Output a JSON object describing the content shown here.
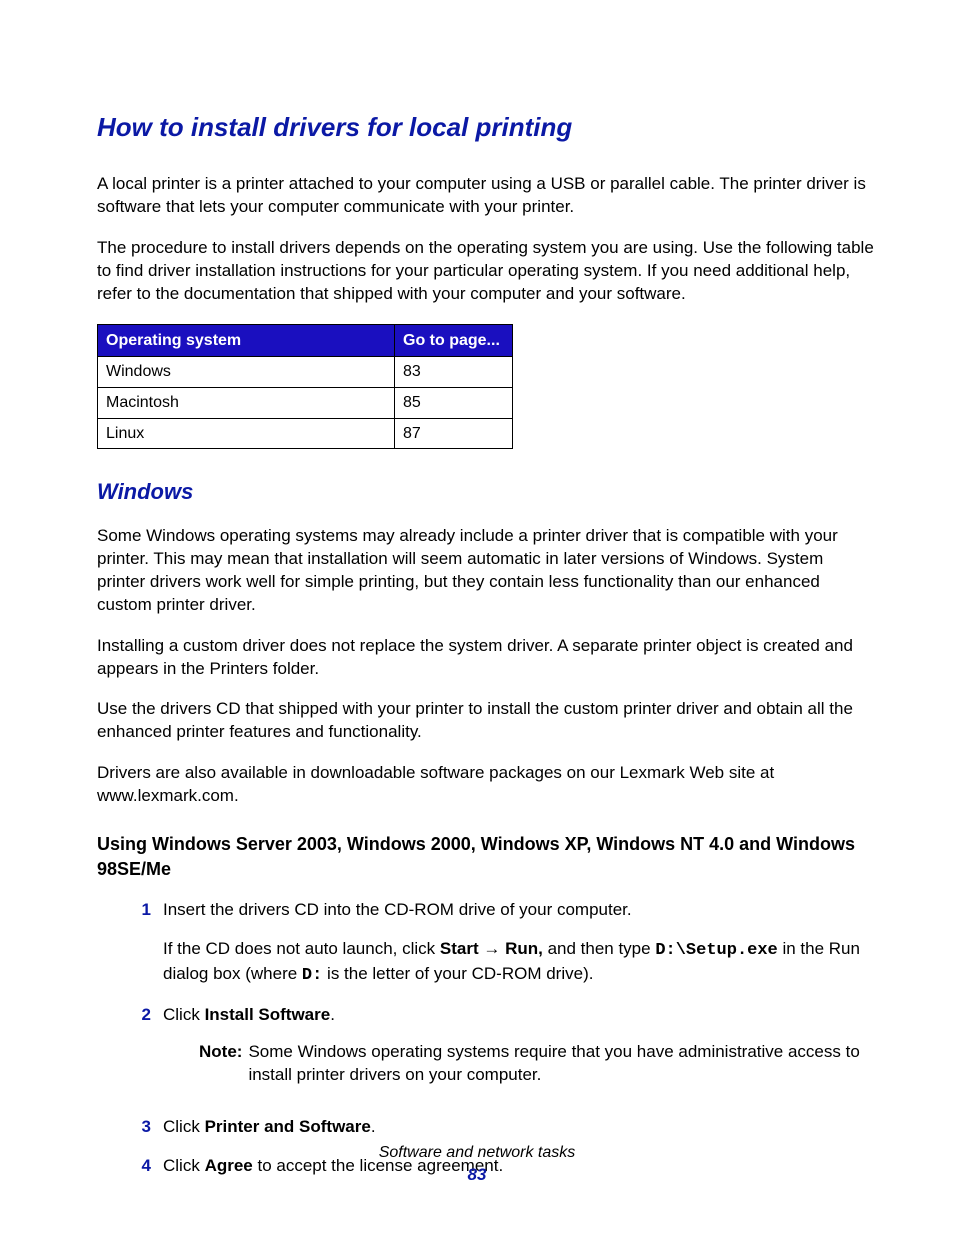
{
  "title": "How to install drivers for local printing",
  "intro1": "A local printer is a printer attached to your computer using a USB or parallel cable. The printer driver is software that lets your computer communicate with your printer.",
  "intro2": "The procedure to install drivers depends on the operating system you are using. Use the following table to find driver installation instructions for your particular operating system. If you need additional help, refer to the documentation that shipped with your computer and your software.",
  "table": {
    "h1": "Operating system",
    "h2": "Go to page...",
    "rows": [
      {
        "os": "Windows",
        "page": "83"
      },
      {
        "os": "Macintosh",
        "page": "85"
      },
      {
        "os": "Linux",
        "page": "87"
      }
    ]
  },
  "win_heading": "Windows",
  "win_p1": "Some Windows operating systems may already include a printer driver that is compatible with your printer. This may mean that installation will seem automatic in later versions of Windows. System printer drivers work well for simple printing, but they contain less functionality than our enhanced custom printer driver.",
  "win_p2": "Installing a custom driver does not replace the system driver. A separate printer object is created and appears in the Printers folder.",
  "win_p3": "Use the drivers CD that shipped with your printer to install the custom printer driver and obtain all the enhanced printer features and functionality.",
  "win_p4": "Drivers are also available in downloadable software packages on our Lexmark Web site at www.lexmark.com.",
  "sub_heading": "Using Windows Server 2003, Windows 2000, Windows XP, Windows NT 4.0 and Windows 98SE/Me",
  "steps": {
    "n1": "1",
    "s1a": "Insert the drivers CD into the CD-ROM drive of your computer.",
    "s1b_pre": "If the CD does not auto launch, click ",
    "s1b_start": "Start",
    "s1b_arrow": " → ",
    "s1b_run": "Run,",
    "s1b_mid": " and then type ",
    "s1b_cmd": "D:\\Setup.exe",
    "s1b_post": " in the Run dialog box (where ",
    "s1b_drive": "D:",
    "s1b_end": " is the letter of your CD-ROM drive).",
    "n2": "2",
    "s2_pre": "Click ",
    "s2_b": "Install Software",
    "s2_post": ".",
    "note_label": "Note:",
    "note_text": " Some Windows operating systems require that you have administrative access to install printer drivers on your computer.",
    "n3": "3",
    "s3_pre": "Click ",
    "s3_b": "Printer and Software",
    "s3_post": ".",
    "n4": "4",
    "s4_pre": "Click ",
    "s4_b": "Agree",
    "s4_post": " to accept the license agreement."
  },
  "footer_title": "Software and network tasks",
  "footer_page": "83"
}
